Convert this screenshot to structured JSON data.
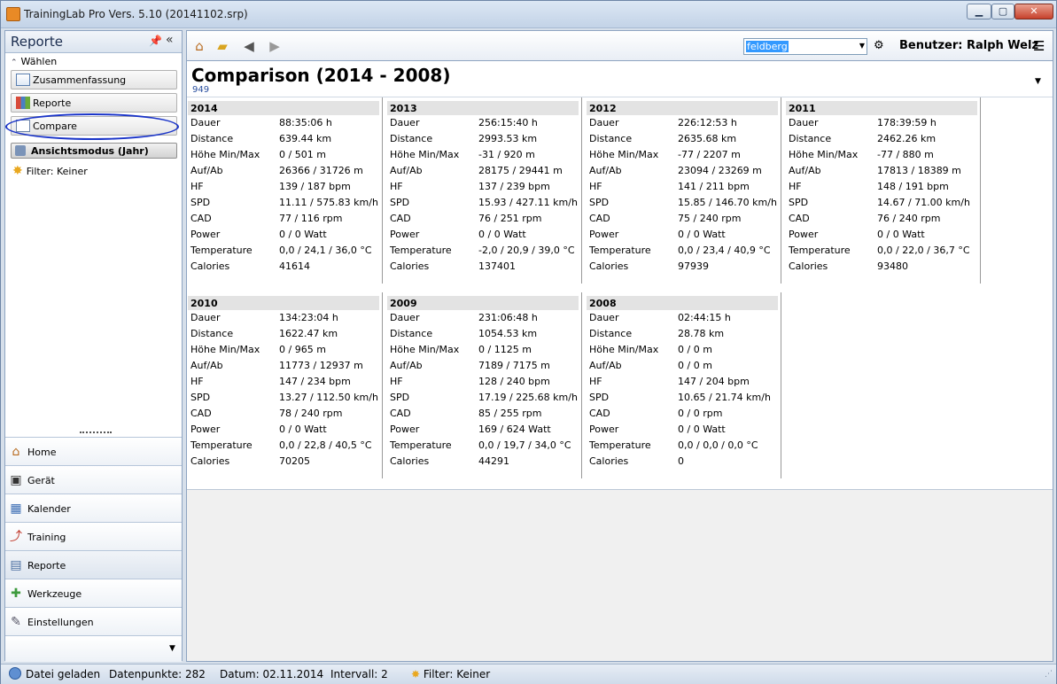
{
  "window": {
    "title": "TrainingLab Pro Vers. 5.10 (20141102.srp)",
    "min": "▁",
    "max": "▢",
    "close": "✕"
  },
  "left": {
    "title": "Reporte",
    "pin": "📌",
    "collapse": "«",
    "wahlen": "Wählen",
    "buttons": [
      "Zusammenfassung",
      "Reporte",
      "Compare"
    ],
    "ansicht": "Ansichtsmodus (Jahr)",
    "filter": "Filter: Keiner",
    "nav": [
      {
        "label": "Home",
        "icon": "⌂"
      },
      {
        "label": "Gerät",
        "icon": "▣"
      },
      {
        "label": "Kalender",
        "icon": "▦"
      },
      {
        "label": "Training",
        "icon": "⤴"
      },
      {
        "label": "Reporte",
        "icon": "▤"
      },
      {
        "label": "Werkzeuge",
        "icon": "✚"
      },
      {
        "label": "Einstellungen",
        "icon": "✎"
      }
    ]
  },
  "toolbar": {
    "search_value": "feldberg",
    "user": "Benutzer: Ralph Welz"
  },
  "main": {
    "title": "Comparison (2014 - 2008)",
    "subtitle": "949"
  },
  "row_labels": [
    "Dauer",
    "Distance",
    "Höhe Min/Max",
    "Auf/Ab",
    "HF",
    "SPD",
    "CAD",
    "Power",
    "Temperature",
    "Calories"
  ],
  "cards": [
    {
      "year": "2014",
      "values": [
        "88:35:06 h",
        "639.44 km",
        "0 / 501 m",
        "26366 / 31726 m",
        "139 / 187 bpm",
        "11.11 / 575.83 km/h",
        "77 / 116 rpm",
        "0 / 0 Watt",
        "0,0 / 24,1 / 36,0 °C",
        "41614"
      ]
    },
    {
      "year": "2013",
      "values": [
        "256:15:40 h",
        "2993.53 km",
        "-31 / 920 m",
        "28175 / 29441 m",
        "137 / 239 bpm",
        "15.93 / 427.11 km/h",
        "76 / 251 rpm",
        "0 / 0 Watt",
        "-2,0 / 20,9 / 39,0 °C",
        "137401"
      ]
    },
    {
      "year": "2012",
      "values": [
        "226:12:53 h",
        "2635.68 km",
        "-77 / 2207 m",
        "23094 / 23269 m",
        "141 / 211 bpm",
        "15.85 / 146.70 km/h",
        "75 / 240 rpm",
        "0 / 0 Watt",
        "0,0 / 23,4 / 40,9 °C",
        "97939"
      ]
    },
    {
      "year": "2011",
      "values": [
        "178:39:59 h",
        "2462.26 km",
        "-77 / 880 m",
        "17813 / 18389 m",
        "148 / 191 bpm",
        "14.67 / 71.00 km/h",
        "76 / 240 rpm",
        "0 / 0 Watt",
        "0,0 / 22,0 / 36,7 °C",
        "93480"
      ]
    },
    {
      "year": "2010",
      "values": [
        "134:23:04 h",
        "1622.47 km",
        "0 / 965 m",
        "11773 / 12937 m",
        "147 / 234 bpm",
        "13.27 / 112.50 km/h",
        "78 / 240 rpm",
        "0 / 0 Watt",
        "0,0 / 22,8 / 40,5 °C",
        "70205"
      ]
    },
    {
      "year": "2009",
      "values": [
        "231:06:48 h",
        "1054.53 km",
        "0 / 1125 m",
        "7189 / 7175 m",
        "128 / 240 bpm",
        "17.19 / 225.68 km/h",
        "85 / 255 rpm",
        "169 / 624 Watt",
        "0,0 / 19,7 / 34,0 °C",
        "44291"
      ]
    },
    {
      "year": "2008",
      "values": [
        "02:44:15 h",
        "28.78 km",
        "0 / 0 m",
        "0 / 0 m",
        "147 / 204 bpm",
        "10.65 / 21.74 km/h",
        "0 / 0 rpm",
        "0 / 0 Watt",
        "0,0 / 0,0 / 0,0 °C",
        "0"
      ]
    }
  ],
  "status": {
    "loaded": "Datei geladen",
    "points": "Datenpunkte: 282",
    "date": "Datum: 02.11.2014",
    "interval": "Intervall: 2",
    "filter": "Filter: Keiner"
  }
}
